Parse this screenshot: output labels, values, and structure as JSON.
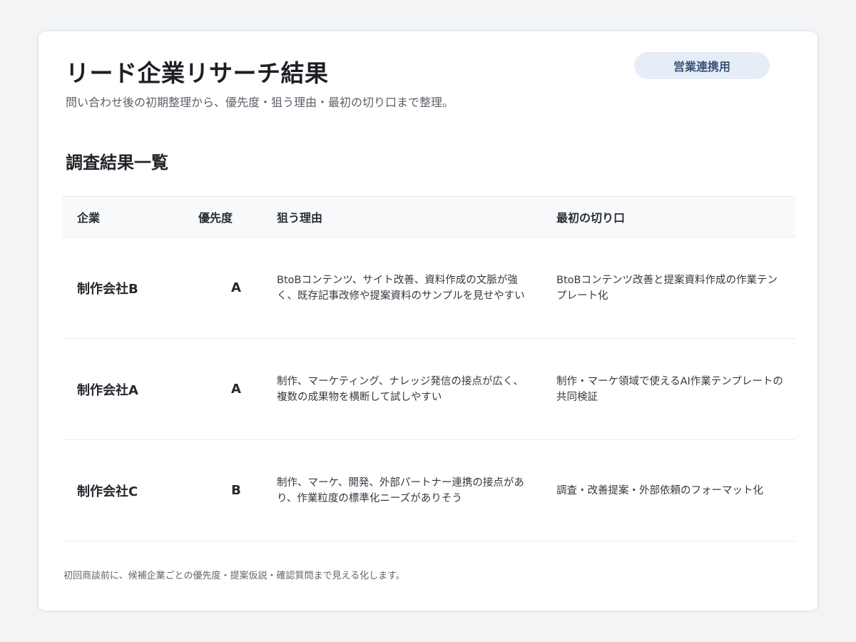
{
  "header": {
    "title": "リード企業リサーチ結果",
    "subtitle": "問い合わせ後の初期整理から、優先度・狙う理由・最初の切り口まで整理。",
    "badge": "営業連携用"
  },
  "section": {
    "title": "調査結果一覧"
  },
  "table": {
    "columns": [
      "企業",
      "優先度",
      "狙う理由",
      "最初の切り口"
    ],
    "rows": [
      {
        "company": "制作会社B",
        "priority": "A",
        "reason": "BtoBコンテンツ、サイト改善、資料作成の文脈が強く、既存記事改修や提案資料のサンプルを見せやすい",
        "approach": "BtoBコンテンツ改善と提案資料作成の作業テンプレート化"
      },
      {
        "company": "制作会社A",
        "priority": "A",
        "reason": "制作、マーケティング、ナレッジ発信の接点が広く、複数の成果物を横断して試しやすい",
        "approach": "制作・マーケ領域で使えるAI作業テンプレートの共同検証"
      },
      {
        "company": "制作会社C",
        "priority": "B",
        "reason": "制作、マーケ、開発、外部パートナー連携の接点があり、作業粒度の標準化ニーズがありそう",
        "approach": "調査・改善提案・外部依頼のフォーマット化"
      }
    ]
  },
  "footer": {
    "note": "初回商談前に、候補企業ごとの優先度・提案仮説・確認質問まで見える化します。"
  },
  "colors": {
    "background": "#f3f4f6",
    "card": "#ffffff",
    "badge_bg": "#e6edf7",
    "badge_text": "#3a5478",
    "header_row_bg": "#f8f9fb",
    "divider": "#e8eaed"
  }
}
